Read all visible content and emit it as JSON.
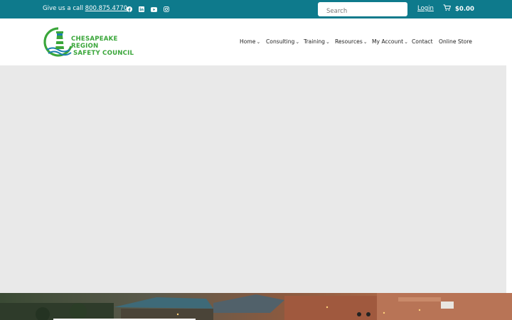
{
  "topbar": {
    "call_prefix": "Give us a call",
    "phone": "800.875.4770",
    "social_icons": [
      "facebook-icon",
      "linkedin-icon",
      "youtube-icon",
      "instagram-icon"
    ],
    "search_placeholder": "Search",
    "login_label": "Login",
    "cart_total": "$0.00",
    "bg_color": "#0e7a8c"
  },
  "logo": {
    "line1": "Chesapeake Region",
    "line2": "Safety Council",
    "brand_color": "#3aa63a",
    "accent_color": "#1c7fb0"
  },
  "nav": {
    "items": [
      {
        "label": "Home",
        "has_dropdown": true
      },
      {
        "label": "Consulting",
        "has_dropdown": true
      },
      {
        "label": "Training",
        "has_dropdown": true
      },
      {
        "label": "Resources",
        "has_dropdown": true
      },
      {
        "label": "My Account",
        "has_dropdown": true
      },
      {
        "label": "Contact",
        "has_dropdown": false
      },
      {
        "label": "Online Store",
        "has_dropdown": false
      }
    ],
    "chevron": "⌄"
  }
}
